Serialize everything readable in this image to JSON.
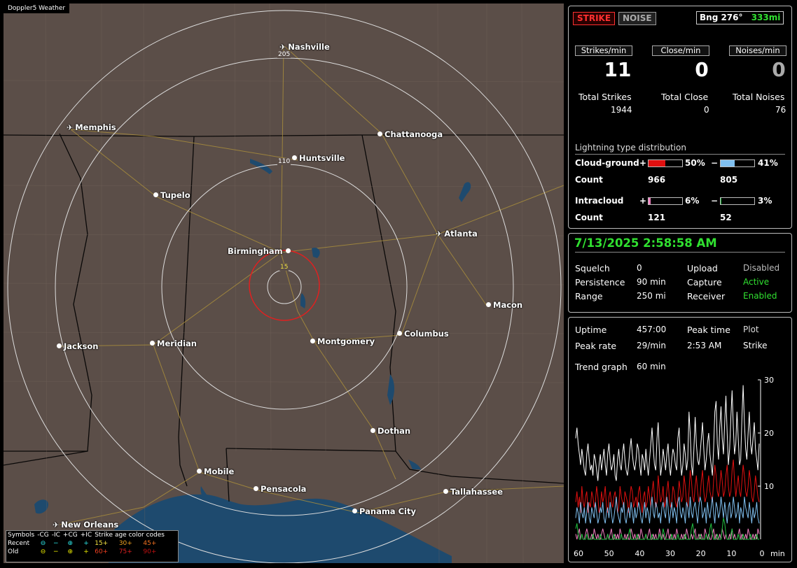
{
  "app_title": "Doppler5 Weather",
  "map": {
    "cities": [
      {
        "name": "Nashville",
        "marker": "plane-icon"
      },
      {
        "name": "Memphis",
        "marker": "plane-icon"
      },
      {
        "name": "Chattanooga",
        "marker": "dot"
      },
      {
        "name": "Huntsville",
        "marker": "dot"
      },
      {
        "name": "Tupelo",
        "marker": "dot"
      },
      {
        "name": "Atlanta",
        "marker": "plane-icon"
      },
      {
        "name": "Birmingham",
        "marker": "dot"
      },
      {
        "name": "Macon",
        "marker": "dot"
      },
      {
        "name": "Jackson",
        "marker": "dot"
      },
      {
        "name": "Meridian",
        "marker": "dot"
      },
      {
        "name": "Montgomery",
        "marker": "dot"
      },
      {
        "name": "Columbus",
        "marker": "dot"
      },
      {
        "name": "Dothan",
        "marker": "dot"
      },
      {
        "name": "Mobile",
        "marker": "dot"
      },
      {
        "name": "Pensacola",
        "marker": "dot"
      },
      {
        "name": "Tallahassee",
        "marker": "dot"
      },
      {
        "name": "Panama City",
        "marker": "dot"
      },
      {
        "name": "New Orleans",
        "marker": "plane-icon"
      }
    ],
    "ring_labels": [
      "205",
      "110",
      "15"
    ]
  },
  "legend": {
    "header": [
      "Symbols",
      "-CG",
      "-IC",
      "+CG",
      "+IC",
      "Strike age color codes"
    ],
    "recent": {
      "label": "Recent",
      "symbols": [
        "⊖",
        "−",
        "⊕",
        "+"
      ],
      "ages": [
        "15+",
        "30+",
        "45+"
      ]
    },
    "old": {
      "label": "Old",
      "symbols": [
        "⊖",
        "−",
        "⊕",
        "+"
      ],
      "ages": [
        "60+",
        "75+",
        "90+"
      ]
    },
    "colors": {
      "recent_symbols": "#2ee6e6",
      "old_symbols": "#e6e600",
      "age1": "#f0e040",
      "age2": "#f0a020",
      "age3": "#f07020",
      "age4": "#f04020",
      "age5": "#e02020",
      "age6": "#c01010"
    }
  },
  "top": {
    "strike_btn": "STRIKE",
    "noise_btn": "NOISE",
    "bearing": "Bng 276°",
    "distance": "333mi"
  },
  "rates": {
    "strikes_label": "Strikes/min",
    "strikes_value": "11",
    "close_label": "Close/min",
    "close_value": "0",
    "noises_label": "Noises/min",
    "noises_value": "0"
  },
  "totals": {
    "strikes_label": "Total Strikes",
    "strikes": "1944",
    "close_label": "Total Close",
    "close": "0",
    "noises_label": "Total Noises",
    "noises": "76"
  },
  "distribution": {
    "title": "Lightning type distribution",
    "cg_label": "Cloud-ground",
    "ic_label": "Intracloud",
    "count_label": "Count",
    "plus": "+",
    "minus": "−",
    "cg_pos_pct": 50,
    "cg_pos_pct_text": "50%",
    "cg_pos_count": "966",
    "cg_neg_pct": 41,
    "cg_neg_pct_text": "41%",
    "cg_neg_count": "805",
    "ic_pos_pct": 6,
    "ic_pos_pct_text": "6%",
    "ic_pos_count": "121",
    "ic_neg_pct": 3,
    "ic_neg_pct_text": "3%",
    "ic_neg_count": "52",
    "colors": {
      "cg_pos": "#e01010",
      "cg_neg": "#80c0f0",
      "ic_pos": "#f080c0",
      "ic_neg": "#20c040"
    }
  },
  "status": {
    "datetime": "7/13/2025 2:58:58 AM",
    "squelch_label": "Squelch",
    "squelch": "0",
    "persistence_label": "Persistence",
    "persistence": "90 min",
    "range_label": "Range",
    "range": "250 mi",
    "upload_label": "Upload",
    "upload": "Disabled",
    "capture_label": "Capture",
    "capture": "Active",
    "receiver_label": "Receiver",
    "receiver": "Enabled"
  },
  "stats": {
    "uptime_label": "Uptime",
    "uptime": "457:00",
    "peak_time_label": "Peak time",
    "peak_time": "2:53 AM",
    "peak_rate_label": "Peak rate",
    "peak_rate": "29/min",
    "plot_label": "Plot",
    "plot": "Strike",
    "trend_label": "Trend graph",
    "trend": "60 min"
  },
  "chart_data": {
    "type": "line",
    "xlabel": "min",
    "x_ticks": [
      "60",
      "50",
      "40",
      "30",
      "20",
      "10",
      "0"
    ],
    "y_ticks": [
      "30",
      "20",
      "10"
    ],
    "ylim": [
      0,
      30
    ],
    "xlim": [
      60,
      0
    ],
    "series": [
      {
        "color": "#ffffff",
        "values": [
          19,
          21,
          18,
          16,
          14,
          17,
          15,
          13,
          12,
          16,
          18,
          15,
          13,
          14,
          12,
          16,
          15,
          13,
          11,
          14,
          16,
          13,
          15,
          17,
          14,
          12,
          16,
          18,
          15,
          13,
          14,
          16,
          12,
          11,
          15,
          17,
          14,
          13,
          16,
          18,
          15,
          13,
          12,
          14,
          17,
          19,
          16,
          14,
          13,
          15,
          18,
          17,
          14,
          12,
          16,
          15,
          13,
          17,
          14,
          12,
          15,
          18,
          21,
          17,
          14,
          13,
          19,
          22,
          16,
          12,
          14,
          17,
          15,
          13,
          16,
          18,
          14,
          12,
          15,
          17,
          16,
          14,
          13,
          19,
          21,
          15,
          12,
          14,
          18,
          16,
          13,
          15,
          24,
          20,
          14,
          12,
          17,
          23,
          18,
          15,
          14,
          16,
          19,
          22,
          17,
          13,
          15,
          18,
          20,
          16,
          14,
          12,
          17,
          24,
          26,
          18,
          15,
          21,
          25,
          19,
          16,
          22,
          27,
          20,
          14,
          17,
          23,
          28,
          21,
          16,
          18,
          24,
          19,
          14,
          15,
          23,
          29,
          22,
          17,
          15,
          20,
          24,
          18,
          16,
          19,
          22,
          17,
          15,
          13,
          18
        ]
      },
      {
        "color": "#e01010",
        "values": [
          7,
          9,
          6,
          8,
          5,
          10,
          7,
          6,
          8,
          9,
          5,
          7,
          6,
          9,
          8,
          6,
          7,
          10,
          8,
          5,
          6,
          9,
          7,
          8,
          10,
          6,
          5,
          8,
          9,
          7,
          6,
          8,
          9,
          7,
          5,
          6,
          10,
          8,
          7,
          6,
          9,
          8,
          7,
          5,
          8,
          10,
          9,
          6,
          7,
          8,
          6,
          9,
          10,
          7,
          5,
          8,
          9,
          6,
          7,
          10,
          8,
          6,
          9,
          11,
          8,
          6,
          7,
          12,
          9,
          7,
          8,
          10,
          6,
          7,
          9,
          11,
          8,
          6,
          7,
          10,
          9,
          7,
          6,
          8,
          11,
          9,
          7,
          8,
          12,
          10,
          7,
          6,
          9,
          13,
          11,
          8,
          7,
          10,
          12,
          9,
          7,
          8,
          11,
          13,
          9,
          7,
          8,
          10,
          12,
          9,
          8,
          7,
          11,
          14,
          12,
          9,
          8,
          10,
          13,
          11,
          8,
          9,
          12,
          14,
          10,
          8,
          9,
          13,
          15,
          11,
          8,
          10,
          12,
          9,
          8,
          11,
          14,
          12,
          9,
          8,
          10,
          13,
          11,
          8,
          7,
          9,
          12,
          10,
          8,
          7
        ]
      },
      {
        "color": "#80c0f0",
        "values": [
          4,
          6,
          5,
          3,
          7,
          5,
          4,
          6,
          3,
          5,
          7,
          4,
          3,
          6,
          5,
          4,
          7,
          5,
          3,
          4,
          6,
          5,
          7,
          4,
          3,
          5,
          6,
          4,
          7,
          5,
          3,
          4,
          6,
          8,
          5,
          4,
          3,
          6,
          5,
          7,
          4,
          3,
          5,
          6,
          4,
          7,
          5,
          3,
          6,
          4,
          5,
          7,
          6,
          4,
          3,
          5,
          7,
          4,
          6,
          5,
          3,
          6,
          8,
          5,
          4,
          7,
          6,
          4,
          5,
          3,
          6,
          7,
          5,
          4,
          8,
          6,
          3,
          5,
          7,
          4,
          6,
          5,
          3,
          7,
          8,
          5,
          4,
          6,
          5,
          3,
          7,
          6,
          4,
          8,
          5,
          4,
          6,
          7,
          5,
          3,
          6,
          8,
          7,
          4,
          5,
          6,
          3,
          7,
          5,
          4,
          6,
          8,
          5,
          3,
          7,
          6,
          4,
          5,
          8,
          6,
          4,
          7,
          5,
          3,
          6,
          7,
          4,
          5,
          8,
          6,
          4,
          5,
          7,
          3,
          6,
          5,
          4,
          8,
          6,
          5,
          4,
          7,
          5,
          3,
          6,
          4,
          5,
          7,
          4,
          3
        ]
      },
      {
        "color": "#f080c0",
        "values": [
          1,
          0,
          1,
          2,
          0,
          1,
          0,
          0,
          1,
          2,
          1,
          0,
          0,
          1,
          0,
          2,
          1,
          0,
          1,
          0,
          0,
          1,
          2,
          1,
          0,
          0,
          1,
          0,
          1,
          2,
          0,
          0,
          1,
          0,
          1,
          0,
          2,
          1,
          0,
          0,
          1,
          0,
          1,
          0,
          0,
          2,
          1,
          0,
          1,
          0,
          0,
          1,
          0,
          2,
          1,
          0,
          0,
          1,
          0,
          1,
          2,
          0,
          0,
          1,
          0,
          1,
          0,
          0,
          2,
          1,
          0,
          1,
          0,
          0,
          1,
          2,
          0,
          1,
          0,
          0,
          1,
          0,
          2,
          1,
          0,
          0,
          1,
          0,
          1,
          0,
          2,
          1,
          0,
          0,
          1,
          0,
          1,
          2,
          0,
          0,
          1,
          0,
          1,
          0,
          0,
          2,
          1,
          0,
          1,
          0,
          0,
          1,
          2,
          0,
          1,
          0,
          0,
          1,
          0,
          2,
          1,
          0,
          1,
          0,
          0,
          1,
          0,
          2,
          0,
          1,
          0,
          0,
          1,
          2,
          0,
          1,
          0,
          0,
          1,
          0,
          2,
          1,
          0,
          0,
          1,
          0,
          1,
          0,
          2,
          1
        ]
      },
      {
        "color": "#20c040",
        "values": [
          2,
          3,
          1,
          0,
          0,
          1,
          0,
          0,
          0,
          1,
          0,
          0,
          0,
          0,
          1,
          0,
          0,
          0,
          0,
          0,
          1,
          0,
          0,
          0,
          0,
          0,
          1,
          0,
          0,
          0,
          0,
          1,
          0,
          0,
          0,
          0,
          0,
          1,
          0,
          0,
          0,
          0,
          0,
          1,
          2,
          0,
          0,
          0,
          0,
          0,
          1,
          0,
          0,
          0,
          0,
          0,
          0,
          1,
          0,
          0,
          0,
          0,
          1,
          0,
          0,
          0,
          0,
          0,
          1,
          0,
          0,
          2,
          1,
          0,
          0,
          0,
          0,
          0,
          1,
          0,
          0,
          0,
          0,
          1,
          0,
          0,
          0,
          0,
          0,
          1,
          0,
          0,
          0,
          0,
          2,
          3,
          1,
          0,
          0,
          0,
          0,
          1,
          0,
          0,
          0,
          0,
          1,
          0,
          0,
          2,
          3,
          1,
          0,
          0,
          0,
          1,
          0,
          0,
          0,
          2,
          4,
          3,
          1,
          0,
          0,
          0,
          1,
          2,
          0,
          0,
          0,
          0,
          1,
          0,
          0,
          0,
          1,
          0,
          0,
          0,
          0,
          0,
          1,
          0,
          0,
          0,
          0,
          1,
          0,
          0
        ]
      }
    ]
  }
}
